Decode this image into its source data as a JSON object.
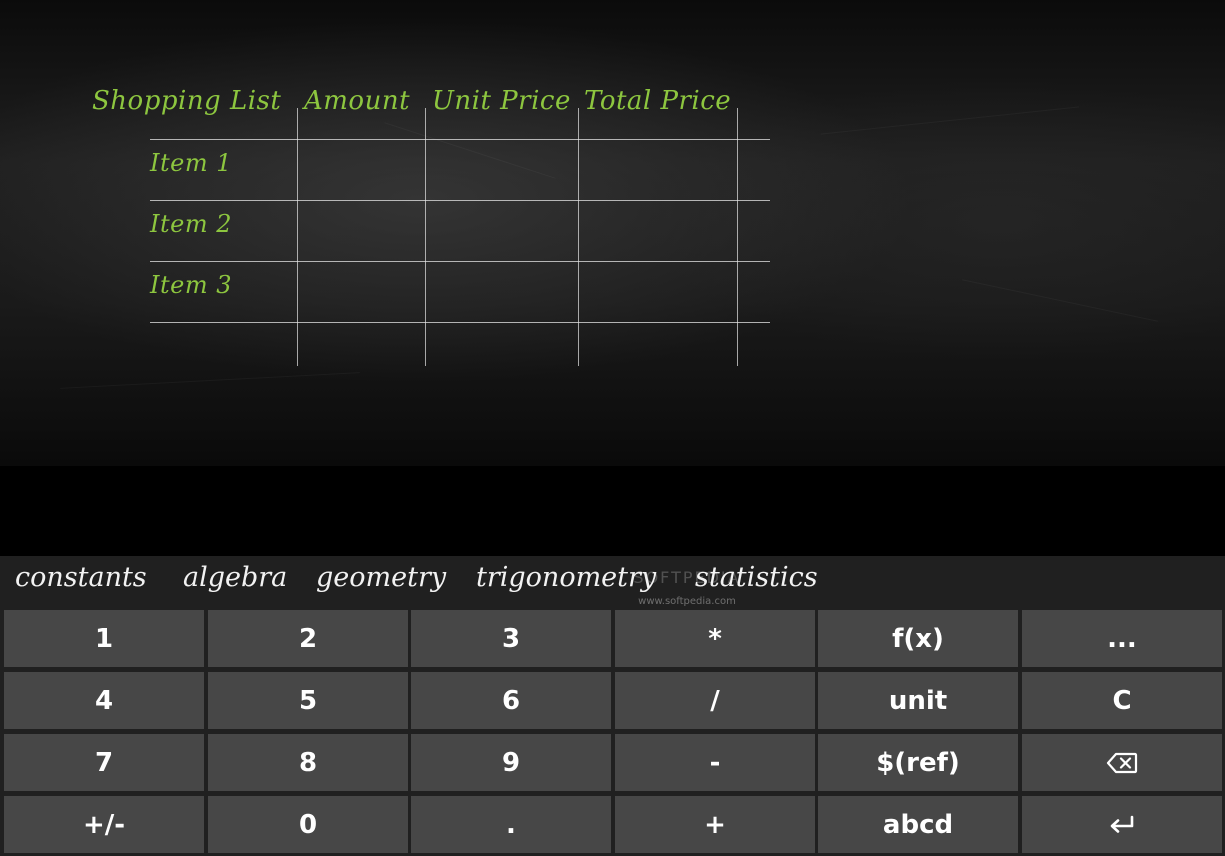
{
  "table": {
    "headers": [
      "Shopping List",
      "Amount",
      "Unit Price",
      "Total Price"
    ],
    "rows": [
      "Item 1",
      "Item 2",
      "Item 3"
    ]
  },
  "tabs": [
    "constants",
    "algebra",
    "geometry",
    "trigonometry",
    "statistics"
  ],
  "watermark": {
    "text": "SOFTPEDIA",
    "url": "www.softpedia.com"
  },
  "keypad": {
    "rows": [
      [
        "1",
        "2",
        "3",
        "*",
        "f(x)",
        "..."
      ],
      [
        "4",
        "5",
        "6",
        "/",
        "unit",
        "C"
      ],
      [
        "7",
        "8",
        "9",
        "-",
        "$(ref)",
        ""
      ],
      [
        "+/-",
        "0",
        ".",
        "+",
        "abcd",
        ""
      ]
    ],
    "icons": {
      "backspace": "backspace-icon",
      "enter": "enter-icon"
    }
  },
  "colors": {
    "chalk_green": "#8dc63f",
    "key_bg": "#474747",
    "panel_bg": "#202020"
  }
}
